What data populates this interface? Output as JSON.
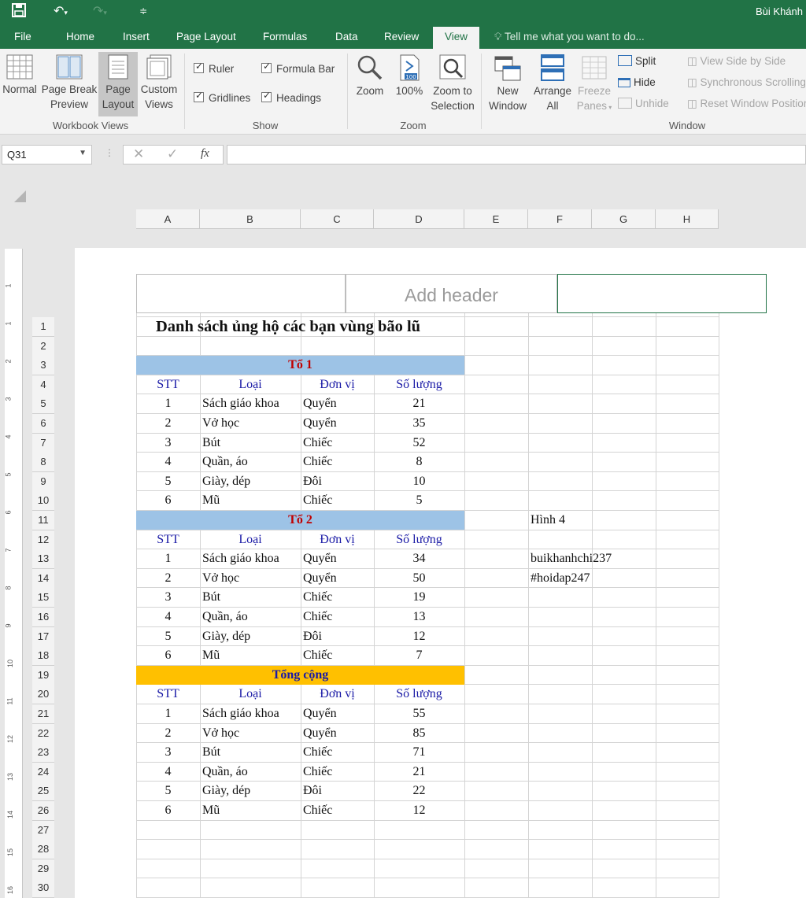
{
  "app": {
    "user": "Bùi Khánh",
    "accent": "#217346"
  },
  "tabs": [
    "File",
    "Home",
    "Insert",
    "Page Layout",
    "Formulas",
    "Data",
    "Review",
    "View"
  ],
  "active_tab": "View",
  "tell_me": "Tell me what you want to do...",
  "ribbon": {
    "workbook_views": {
      "label": "Workbook Views",
      "normal": "Normal",
      "page_break_1": "Page Break",
      "page_break_2": "Preview",
      "page_layout_1": "Page",
      "page_layout_2": "Layout",
      "custom_1": "Custom",
      "custom_2": "Views"
    },
    "show": {
      "label": "Show",
      "ruler": "Ruler",
      "formula_bar": "Formula Bar",
      "gridlines": "Gridlines",
      "headings": "Headings"
    },
    "zoom": {
      "label": "Zoom",
      "zoom": "Zoom",
      "hundred": "100%",
      "hundred_icon": "100",
      "zts_1": "Zoom to",
      "zts_2": "Selection"
    },
    "window": {
      "label": "Window",
      "new_1": "New",
      "new_2": "Window",
      "arrange_1": "Arrange",
      "arrange_2": "All",
      "freeze_1": "Freeze",
      "freeze_2": "Panes",
      "split": "Split",
      "hide": "Hide",
      "unhide": "Unhide",
      "side_by_side": "View Side by Side",
      "sync": "Synchronous Scrolling",
      "reset": "Reset Window Position"
    }
  },
  "formula_bar": {
    "name_box": "Q31",
    "formula": ""
  },
  "columns": [
    "A",
    "B",
    "C",
    "D",
    "E",
    "F",
    "G",
    "H"
  ],
  "rows": [
    "1",
    "2",
    "3",
    "4",
    "5",
    "6",
    "7",
    "8",
    "9",
    "10",
    "11",
    "12",
    "13",
    "14",
    "15",
    "16",
    "17",
    "18",
    "19",
    "20",
    "21",
    "22",
    "23",
    "24",
    "25",
    "26",
    "27",
    "28",
    "29",
    "30"
  ],
  "ruler_marks": [
    "1",
    "1",
    "2",
    "3",
    "4",
    "5",
    "6",
    "7",
    "8",
    "9",
    "10",
    "11",
    "12",
    "13",
    "14",
    "15",
    "16"
  ],
  "page_header": {
    "center": "Add header"
  },
  "sheet": {
    "title": "Danh sách ủng hộ các bạn vùng bão lũ",
    "table_headers": [
      "STT",
      "Loại",
      "Đơn vị",
      "Số lượng"
    ],
    "groups": [
      {
        "name": "Tổ 1",
        "name_color": "#c00000",
        "band_color": "#9dc3e6",
        "rows": [
          [
            "1",
            "Sách giáo khoa",
            "Quyển",
            "21"
          ],
          [
            "2",
            "Vở học",
            "Quyển",
            "35"
          ],
          [
            "3",
            "Bút",
            "Chiếc",
            "52"
          ],
          [
            "4",
            "Quần, áo",
            "Chiếc",
            "8"
          ],
          [
            "5",
            "Giày, dép",
            "Đôi",
            "10"
          ],
          [
            "6",
            "Mũ",
            "Chiếc",
            "5"
          ]
        ]
      },
      {
        "name": "Tổ 2",
        "name_color": "#c00000",
        "band_color": "#9dc3e6",
        "rows": [
          [
            "1",
            "Sách giáo khoa",
            "Quyển",
            "34"
          ],
          [
            "2",
            "Vở học",
            "Quyển",
            "50"
          ],
          [
            "3",
            "Bút",
            "Chiếc",
            "19"
          ],
          [
            "4",
            "Quần, áo",
            "Chiếc",
            "13"
          ],
          [
            "5",
            "Giày, dép",
            "Đôi",
            "12"
          ],
          [
            "6",
            "Mũ",
            "Chiếc",
            "7"
          ]
        ]
      },
      {
        "name": "Tổng cộng",
        "name_color": "#1a1aa6",
        "band_color": "#ffc000",
        "rows": [
          [
            "1",
            "Sách giáo khoa",
            "Quyển",
            "55"
          ],
          [
            "2",
            "Vở học",
            "Quyển",
            "85"
          ],
          [
            "3",
            "Bút",
            "Chiếc",
            "71"
          ],
          [
            "4",
            "Quần, áo",
            "Chiếc",
            "21"
          ],
          [
            "5",
            "Giày, dép",
            "Đôi",
            "22"
          ],
          [
            "6",
            "Mũ",
            "Chiếc",
            "12"
          ]
        ]
      }
    ],
    "notes": {
      "f11": "Hình 4",
      "f13": "buikhanhchi237",
      "f14": "#hoidap247"
    }
  }
}
